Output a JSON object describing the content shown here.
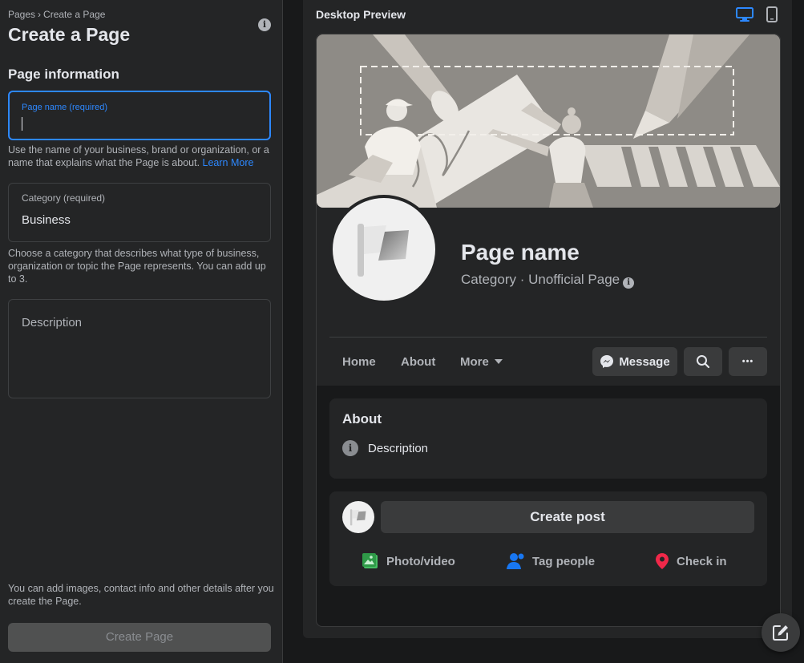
{
  "left_panel": {
    "breadcrumb": {
      "parent": "Pages",
      "separator": "›",
      "current": "Create a Page"
    },
    "title": "Create a Page",
    "section_title": "Page information",
    "page_name_field": {
      "label": "Page name (required)",
      "value": ""
    },
    "page_name_help": "Use the name of your business, brand or organization, or a name that explains what the Page is about.",
    "learn_more": "Learn More",
    "category_field": {
      "label": "Category (required)",
      "value": "Business"
    },
    "category_help": "Choose a category that describes what type of business, organization or topic the Page represents. You can add up to 3.",
    "description_field": {
      "placeholder": "Description"
    },
    "footer_note": "You can add images, contact info and other details after you create the Page.",
    "create_button": "Create Page"
  },
  "preview": {
    "title": "Desktop Preview",
    "devices": [
      {
        "name": "desktop",
        "active": true
      },
      {
        "name": "mobile",
        "active": false
      }
    ],
    "page_name": "Page name",
    "category_line": "Category · Unofficial Page",
    "tabs": [
      {
        "label": "Home"
      },
      {
        "label": "About"
      },
      {
        "label": "More"
      }
    ],
    "message_button": "Message",
    "more_dots": "•••",
    "about": {
      "title": "About",
      "description": "Description"
    },
    "post": {
      "create_label": "Create post",
      "actions": [
        {
          "label": "Photo/video",
          "icon": "photo-video-icon",
          "color": "#45bd62"
        },
        {
          "label": "Tag people",
          "icon": "tag-people-icon",
          "color": "#1877f2"
        },
        {
          "label": "Check in",
          "icon": "check-in-icon",
          "color": "#f02849"
        }
      ]
    }
  },
  "colors": {
    "accent": "#2d88ff",
    "panel": "#242526",
    "background": "#18191a"
  }
}
